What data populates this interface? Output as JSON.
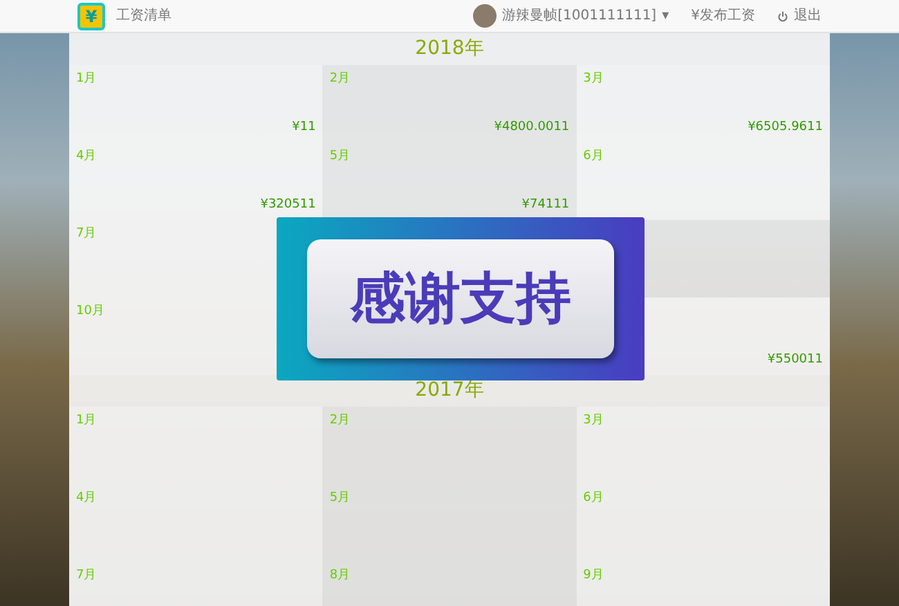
{
  "navbar": {
    "brand_icon": "¥",
    "brand": "工资清单",
    "user": "游辣曼帧[1001111111]",
    "caret": "▾",
    "links": [
      {
        "kind": "publish",
        "label": "¥发布工资"
      },
      {
        "kind": "logout",
        "label": "退出"
      }
    ]
  },
  "years": [
    {
      "title": "2018年",
      "months": [
        {
          "label": "1月",
          "amount": "¥11"
        },
        {
          "label": "2月",
          "amount": "¥4800.0011"
        },
        {
          "label": "3月",
          "amount": "¥6505.9611"
        },
        {
          "label": "4月",
          "amount": "¥320511"
        },
        {
          "label": "5月",
          "amount": "¥74111"
        },
        {
          "label": "6月"
        },
        {
          "label": "7月"
        },
        {
          "kind": "covered"
        },
        {
          "kind": "covered"
        },
        {
          "label": "10月"
        },
        {
          "kind": "covered"
        },
        {
          "amount": "¥550011"
        }
      ]
    },
    {
      "title": "2017年",
      "months": [
        {
          "label": "1月"
        },
        {
          "label": "2月"
        },
        {
          "label": "3月"
        },
        {
          "label": "4月"
        },
        {
          "label": "5月"
        },
        {
          "label": "6月"
        },
        {
          "label": "7月"
        },
        {
          "label": "8月"
        },
        {
          "label": "9月"
        }
      ]
    }
  ],
  "banner": {
    "text": "感谢支持"
  }
}
